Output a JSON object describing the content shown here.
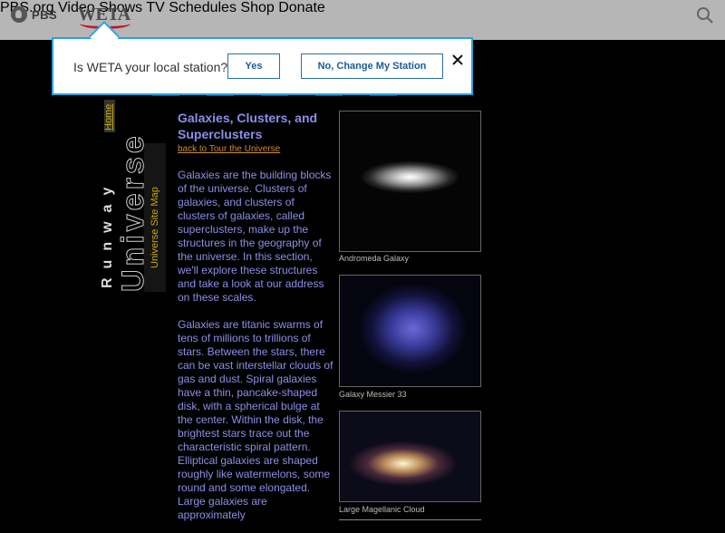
{
  "header": {
    "pbs_label": "PBS",
    "weta_label": "WETA",
    "nav": [
      "PBS.org",
      "Video",
      "Shows",
      "TV Schedules",
      "Shop",
      "Donate"
    ]
  },
  "popup": {
    "question": "Is WETA your local station?",
    "yes_label": "Yes",
    "no_label": "No, Change My Station"
  },
  "sidebar": {
    "runway": "Runway",
    "universe": "Universe",
    "home": "Home",
    "site_map": "Universe Site Map"
  },
  "article": {
    "title": "Galaxies, Clusters, and Superclusters",
    "back_link": "back to Tour the Universe",
    "para1": "Galaxies are the building blocks of the universe. Clusters of galaxies, and clusters of clusters of galaxies, called superclusters, make up the structures in the geography of the universe. In this section, we'll explore these structures and take a look at our address on these scales.",
    "para2": "Galaxies are titanic swarms of tens of millions to trillions of stars. Between the stars, there can be vast interstellar clouds of gas and dust. Spiral galaxies have a thin, pancake-shaped disk, with a spherical bulge at the center. Within the disk, the brightest stars trace out the characteristic spiral pattern. Elliptical galaxies are shaped roughly like watermelons, some round and some elongated. Large galaxies are approximately"
  },
  "images": [
    {
      "caption": "Andromeda Galaxy"
    },
    {
      "caption": "Galaxy Messier 33"
    },
    {
      "caption": "Large Magellanic Cloud"
    }
  ],
  "colors": {
    "header_bg": "#b6b6b6",
    "popup_border": "#29a3dd",
    "body_bg": "#000000",
    "text_purple": "#8e8ee8",
    "link_orange": "#d08b2c"
  }
}
